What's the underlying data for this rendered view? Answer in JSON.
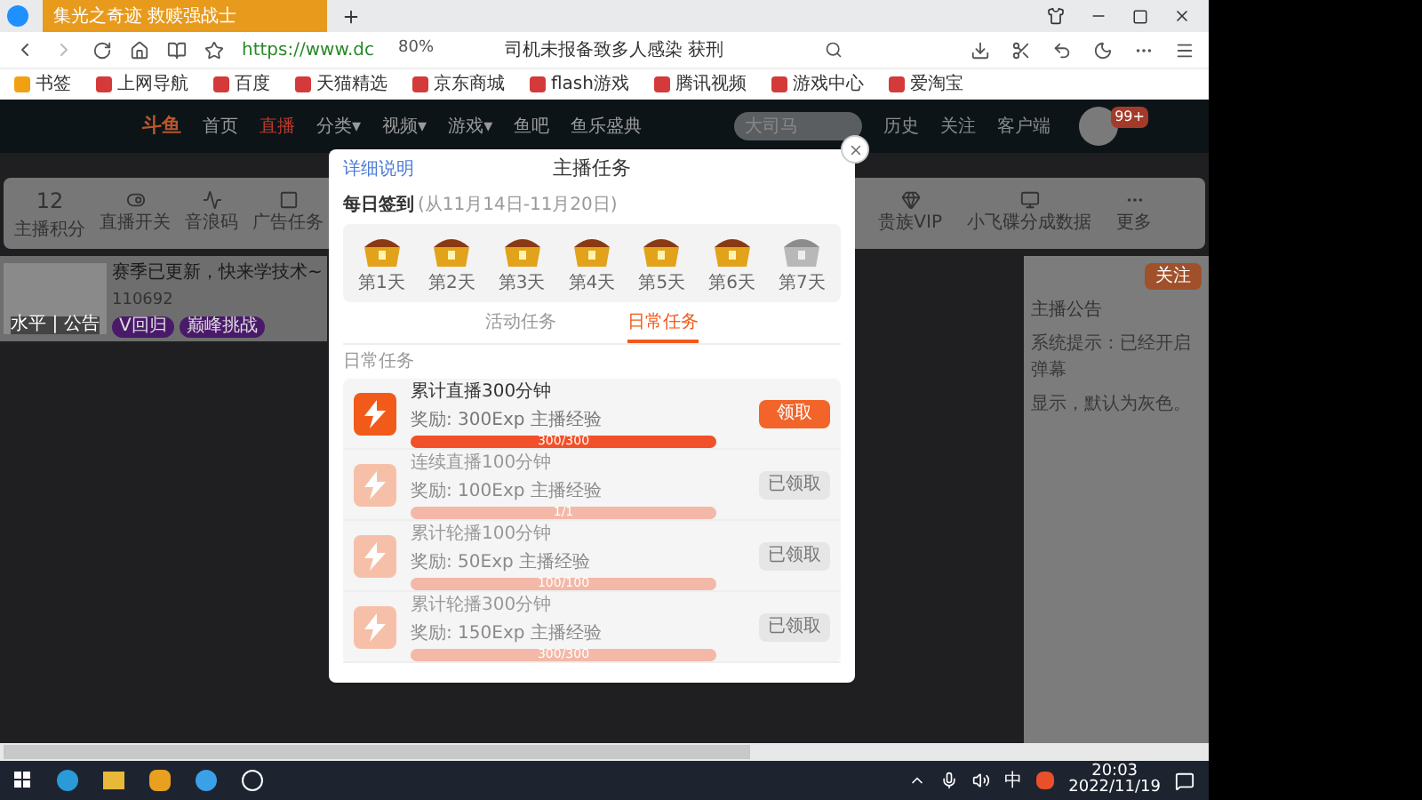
{
  "browser": {
    "tab_title": "集光之奇迹 救赎强战士",
    "url": "https://www.dc",
    "zoom": "80%",
    "news": "司机未报备致多人感染 获刑",
    "bookmarks": [
      "书签",
      "上网导航",
      "百度",
      "天猫精选",
      "京东商城",
      "flash游戏",
      "腾讯视频",
      "游戏中心",
      "爱淘宝"
    ]
  },
  "site_nav": {
    "logo": "斗鱼",
    "items": [
      {
        "label": "首页",
        "selected": false
      },
      {
        "label": "直播",
        "selected": true
      },
      {
        "label": "分类▾",
        "selected": false
      },
      {
        "label": "视频▾",
        "selected": false
      },
      {
        "label": "游戏▾",
        "selected": false
      },
      {
        "label": "鱼吧",
        "selected": false
      },
      {
        "label": "鱼乐盛典",
        "selected": false
      }
    ],
    "search": {
      "placeholder": "大司马"
    },
    "actions": [
      "历史",
      "关注",
      "客户端"
    ],
    "avatar_badge": "99+"
  },
  "toolbar": {
    "score": "12",
    "left_items": [
      "主播积分",
      "直播开关",
      "音浪码",
      "广告任务"
    ],
    "right_items": [
      "贵族VIP",
      "小飞碟分成数据",
      "更多"
    ]
  },
  "stream_card": {
    "title": "赛季已更新，快来学技术~",
    "count": "110692",
    "photo_caption": "水平 | 公告",
    "tags": [
      "V回归",
      "巅峰挑战"
    ]
  },
  "side_panel": {
    "button": "关注",
    "heading": "主播公告",
    "lines": [
      "系统提示：已经开启弹幕",
      "显示，默认为灰色。"
    ]
  },
  "modal": {
    "help_link": "详细说明",
    "title": "主播任务",
    "checkin_label": "每日签到",
    "checkin_range": "(从11月14日-11月20日)",
    "days": [
      {
        "label": "第1天",
        "claimed": true
      },
      {
        "label": "第2天",
        "claimed": true
      },
      {
        "label": "第3天",
        "claimed": true
      },
      {
        "label": "第4天",
        "claimed": true
      },
      {
        "label": "第5天",
        "claimed": true
      },
      {
        "label": "第6天",
        "claimed": true
      },
      {
        "label": "第7天",
        "claimed": false
      }
    ],
    "tabs": [
      {
        "label": "活动任务",
        "selected": false
      },
      {
        "label": "日常任务",
        "selected": true
      }
    ],
    "section": "日常任务",
    "tasks": [
      {
        "name": "累计直播300分钟",
        "reward": "奖励: 300Exp 主播经验",
        "progress": "300/300",
        "level": 1,
        "button": "领取",
        "claimed": false
      },
      {
        "name": "连续直播100分钟",
        "reward": "奖励: 100Exp 主播经验",
        "progress": "1/1",
        "level": 1,
        "button": "已领取",
        "claimed": true
      },
      {
        "name": "累计轮播100分钟",
        "reward": "奖励: 50Exp 主播经验",
        "progress": "100/100",
        "level": 1,
        "button": "已领取",
        "claimed": true
      },
      {
        "name": "累计轮播300分钟",
        "reward": "奖励: 150Exp 主播经验",
        "progress": "300/300",
        "level": 1,
        "button": "已领取",
        "claimed": true
      }
    ]
  },
  "taskbar": {
    "ime": "中",
    "time": "20:03",
    "date": "2022/11/19"
  }
}
